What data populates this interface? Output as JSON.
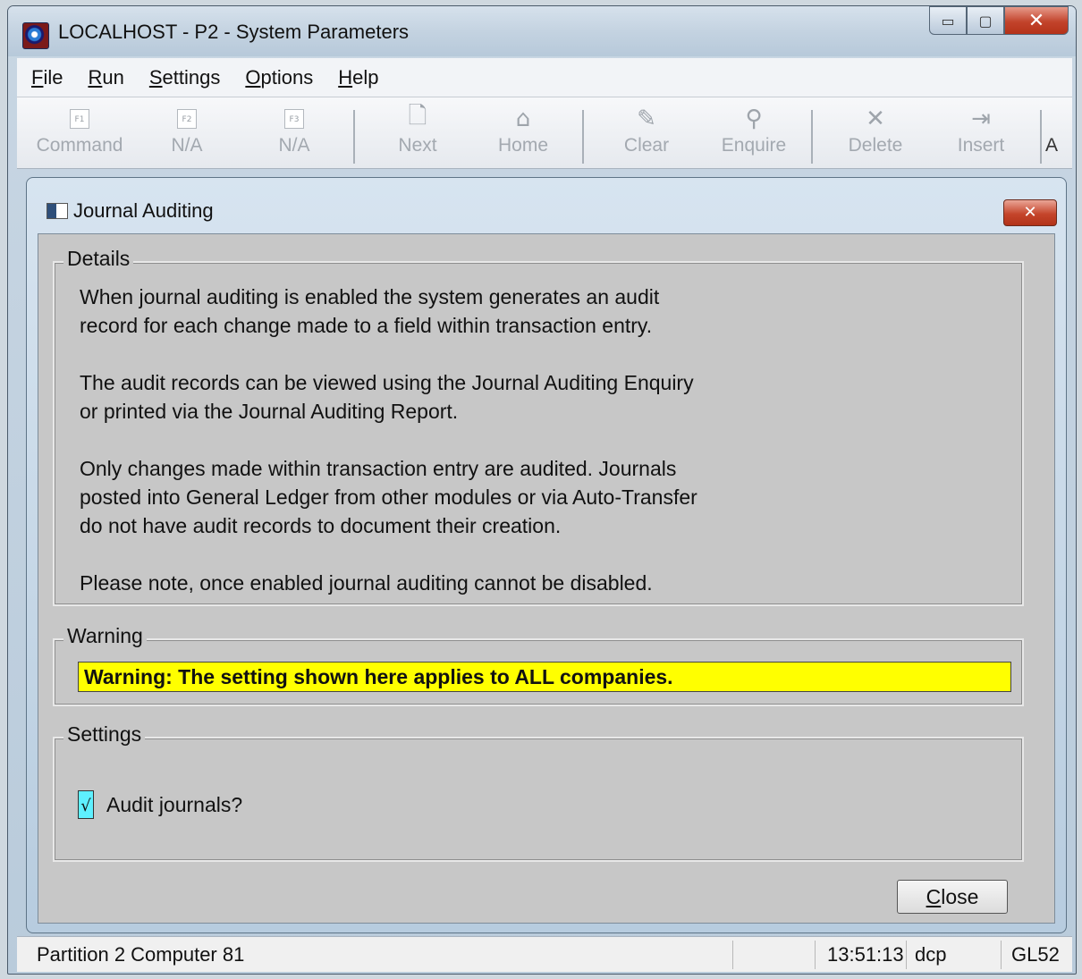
{
  "window": {
    "title": "LOCALHOST - P2 - System Parameters",
    "min_glyph": "▭",
    "max_glyph": "▢",
    "close_glyph": "✕"
  },
  "menu": {
    "items": [
      {
        "u": "F",
        "rest": "ile"
      },
      {
        "u": "R",
        "rest": "un"
      },
      {
        "u": "S",
        "rest": "ettings"
      },
      {
        "u": "O",
        "rest": "ptions"
      },
      {
        "u": "H",
        "rest": "elp"
      }
    ]
  },
  "toolbar": {
    "buttons": [
      {
        "label": "Command",
        "fkey": "F1",
        "icon": "f1-key-icon"
      },
      {
        "label": "N/A",
        "fkey": "F2",
        "icon": "f2-key-icon"
      },
      {
        "label": "N/A",
        "fkey": "F3",
        "icon": "f3-key-icon"
      },
      {
        "label": "Next",
        "icon": "next-page-icon",
        "glyph": "🗋"
      },
      {
        "label": "Home",
        "icon": "home-icon",
        "glyph": "⌂"
      },
      {
        "label": "Clear",
        "icon": "clear-icon",
        "glyph": "✎"
      },
      {
        "label": "Enquire",
        "icon": "search-icon",
        "glyph": "⚲"
      },
      {
        "label": "Delete",
        "icon": "delete-icon",
        "glyph": "✕"
      },
      {
        "label": "Insert",
        "icon": "insert-icon",
        "glyph": "⇥"
      }
    ],
    "overflow_label": "A"
  },
  "dialog": {
    "title": "Journal Auditing",
    "close_glyph": "✕",
    "details": {
      "legend": "Details",
      "paragraphs": [
        "When journal auditing is enabled the system generates an audit\nrecord for each change made to a field within transaction entry.",
        "The audit records can be viewed using the Journal Auditing Enquiry\nor printed via the Journal Auditing Report.",
        "Only changes made within transaction entry are audited.  Journals\nposted into General Ledger from other modules or via Auto-Transfer\ndo not have audit records to document their creation.",
        "Please note, once enabled journal auditing cannot be disabled."
      ]
    },
    "warning": {
      "legend": "Warning",
      "text": "Warning: The setting shown here applies to ALL companies.",
      "color": "#ffff00"
    },
    "settings": {
      "legend": "Settings",
      "audit_journals": {
        "label": "Audit journals?",
        "checked": true,
        "mark": "√"
      }
    },
    "close_button": {
      "u": "C",
      "rest": "lose"
    }
  },
  "status": {
    "partition": "Partition 2 Computer 81",
    "time": "13:51:13",
    "user": "dcp",
    "code": "GL52"
  }
}
